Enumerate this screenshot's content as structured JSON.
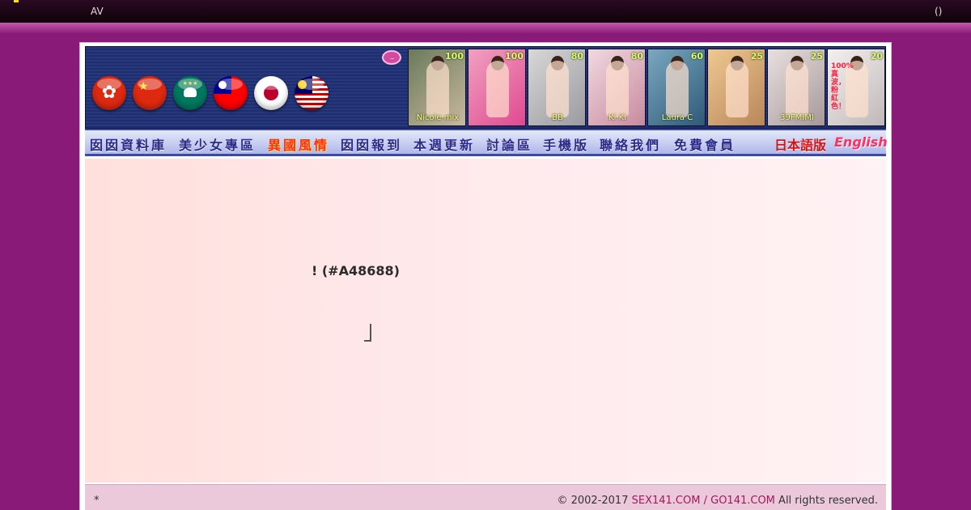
{
  "topbar": {
    "left_text": "AV",
    "right_text": "()"
  },
  "header": {
    "flags": [
      {
        "name": "hong-kong"
      },
      {
        "name": "china"
      },
      {
        "name": "macau"
      },
      {
        "name": "taiwan"
      },
      {
        "name": "japan"
      },
      {
        "name": "malaysia"
      }
    ],
    "chat_icon_label": "...",
    "thumbnails": [
      {
        "score": "100",
        "name": "Nicole mix"
      },
      {
        "score": "100",
        "name": ""
      },
      {
        "score": "80",
        "name": "BB"
      },
      {
        "score": "80",
        "name": "Ki Ki"
      },
      {
        "score": "60",
        "name": "Laura C"
      },
      {
        "score": "25",
        "name": ""
      },
      {
        "score": "25",
        "name": "39FMIMI"
      },
      {
        "score": "20",
        "name": "",
        "side_text": "100%真波，粉紅色！"
      }
    ]
  },
  "nav": {
    "items": [
      "囡囡資料庫",
      "美少女專區",
      "異國風情",
      "囡囡報到",
      "本週更新",
      "討論區",
      "手機版",
      "聯絡我們",
      "免費會員"
    ],
    "japanese": "日本語版",
    "english": "English"
  },
  "content": {
    "message": "! (#A48688)"
  },
  "footer": {
    "star": "*",
    "copyright": "© 2002-2017",
    "site1": "SEX141.COM",
    "separator": "/",
    "site2": "GO141.COM",
    "rights": "All rights reserved."
  },
  "colors": {
    "background": "#8a1a78",
    "nav_text": "#2a2a8c",
    "hot_nav": "#ff3018",
    "link": "#a01a5a"
  }
}
